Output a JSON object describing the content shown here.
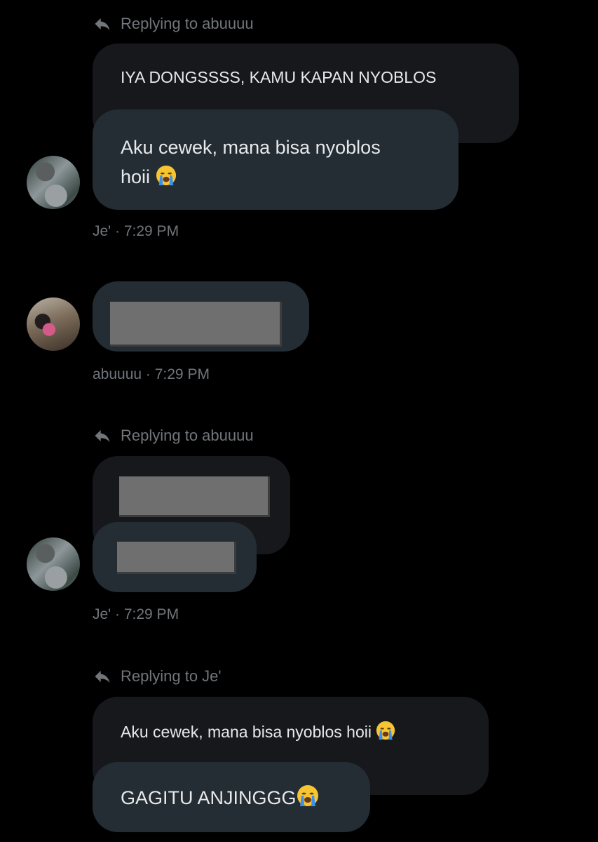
{
  "colors": {
    "background": "#000000",
    "bubble_main": "#242d34",
    "bubble_quoted": "#16181c",
    "text_primary": "#e7e9ea",
    "text_secondary": "#71767b"
  },
  "icons": {
    "reply": "reply-arrow-icon",
    "emoji": "loudly-crying-face-emoji"
  },
  "messages": [
    {
      "reply_label": "Replying to abuuuu",
      "quoted_text": "IYA DONGSSSS, KAMU KAPAN NYOBLOS",
      "text_line1": "Aku cewek, mana bisa nyoblos",
      "text_line2": "hoii",
      "sender": "Je'",
      "time": "7:29 PM",
      "meta": "Je' · 7:29 PM"
    },
    {
      "meta": "abuuuu · 7:29 PM",
      "sender": "abuuuu",
      "time": "7:29 PM"
    },
    {
      "reply_label": "Replying to abuuuu",
      "meta": "Je' · 7:29 PM",
      "sender": "Je'",
      "time": "7:29 PM"
    },
    {
      "reply_label": "Replying to Je'",
      "quoted_text": "Aku cewek, mana bisa nyoblos hoii",
      "text": "GAGITU ANJINGGG"
    }
  ]
}
